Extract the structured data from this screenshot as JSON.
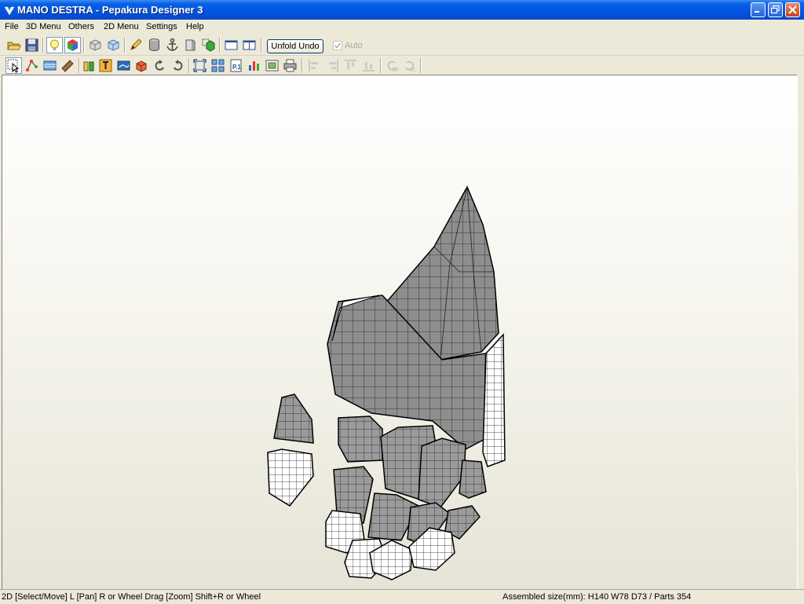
{
  "window": {
    "title": "MANO DESTRA - Pepakura Designer 3",
    "controls": [
      "minimize",
      "maximize",
      "close"
    ]
  },
  "menubar": {
    "items": [
      {
        "label": "File"
      },
      {
        "label": "3D Menu"
      },
      {
        "label": "Others"
      },
      {
        "label": "2D Menu"
      },
      {
        "label": "Settings"
      },
      {
        "label": "Help"
      }
    ]
  },
  "toolbar1": {
    "unfold_undo_label": "Unfold Undo",
    "auto_label": "Auto",
    "auto_checked": true,
    "auto_enabled": false,
    "icons": [
      "open-icon",
      "save-icon",
      "light-icon",
      "texture-icon",
      "front-view-icon",
      "side-view-icon",
      "pencil-icon",
      "cylinder-icon",
      "anchor-icon",
      "edge-icon",
      "cube-icon",
      "single-view-icon",
      "split-view-icon"
    ]
  },
  "toolbar2": {
    "icons": [
      "select-icon",
      "edge-edit-icon",
      "print-area-icon",
      "edit-icon",
      "join-icon",
      "text-icon",
      "image-icon",
      "unfold-icon",
      "rotate-back-icon",
      "rotate-icon",
      "fit-icon",
      "arrange-icon",
      "page-icon",
      "chart-icon",
      "photo-icon",
      "print-icon",
      "align-left-icon",
      "align-center-icon",
      "align-top-icon",
      "align-bottom-icon",
      "rotate-90-left-icon",
      "rotate-90-right-icon"
    ]
  },
  "status": {
    "left": "2D [Select/Move] L [Pan] R or Wheel Drag [Zoom] Shift+R or Wheel",
    "right": "Assembled size(mm): H140 W78 D73 / Parts 354"
  },
  "colors": {
    "titlebar": "#0054e3",
    "chrome": "#ece9d8",
    "mesh_dark": "#8c8c8c",
    "mesh_light": "#ffffff"
  }
}
